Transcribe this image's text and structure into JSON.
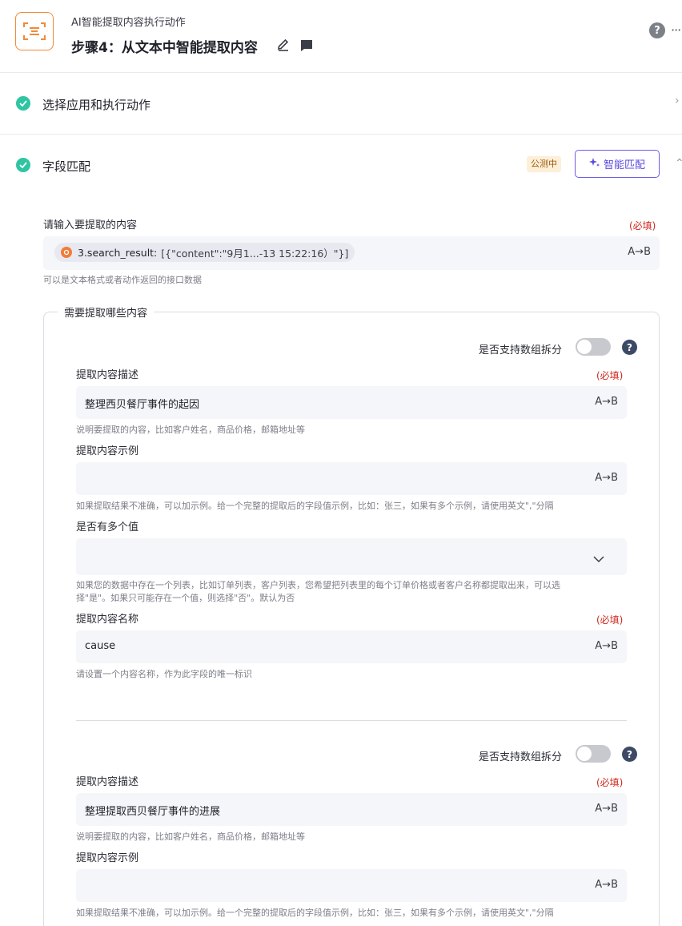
{
  "header": {
    "subtitle": "AI智能提取内容执行动作",
    "title": "步骤4：从文本中智能提取内容",
    "help_label": "?",
    "more_label": "···"
  },
  "sections": {
    "choose_app": {
      "title": "选择应用和执行动作",
      "chevron": "›"
    },
    "field_match": {
      "title": "字段匹配",
      "badge": "公测中",
      "smart_match_label": "智能匹配",
      "chevron": "⌃"
    }
  },
  "input_content": {
    "label": "请输入要提取的内容",
    "required": "(必填)",
    "token_key": "3.search_result:",
    "token_value": "[{\"content\":\"9月1...-13 15:22:16）\"}]",
    "ab_label": "A→B",
    "hint": "可以是文本格式或者动作返回的接口数据"
  },
  "extract_box": {
    "legend": "需要提取哪些内容",
    "items": [
      {
        "toggle_label": "是否支持数组拆分",
        "help": "?",
        "desc_label": "提取内容描述",
        "desc_required": "(必填)",
        "desc_value": "整理西贝餐厅事件的起因",
        "desc_hint": "说明要提取的内容，比如客户姓名，商品价格，邮箱地址等",
        "example_label": "提取内容示例",
        "example_value": "",
        "example_hint": "如果提取结果不准确，可以加示例。给一个完整的提取后的字段值示例，比如：张三，如果有多个示例，请使用英文\",\"分隔",
        "multi_label": "是否有多个值",
        "multi_value": "",
        "multi_hint_1": "如果您的数据中存在一个列表，比如订单列表，客户列表，您希望把列表里的每个订单价格或者客户名称都提取出来，可以选",
        "multi_hint_2": "择\"是\"。如果只可能存在一个值，则选择\"否\"。默认为否",
        "name_label": "提取内容名称",
        "name_required": "(必填)",
        "name_value": "cause",
        "name_hint": "请设置一个内容名称，作为此字段的唯一标识",
        "toggle_on": false
      },
      {
        "toggle_label": "是否支持数组拆分",
        "help": "?",
        "desc_label": "提取内容描述",
        "desc_required": "(必填)",
        "desc_value": "整理提取西贝餐厅事件的进展",
        "desc_hint": "说明要提取的内容，比如客户姓名，商品价格，邮箱地址等",
        "example_label": "提取内容示例",
        "example_value": "",
        "example_hint": "如果提取结果不准确，可以加示例。给一个完整的提取后的字段值示例，比如：张三，如果有多个示例，请使用英文\",\"分隔",
        "toggle_on": false
      }
    ]
  },
  "colors": {
    "accent_orange": "#f08a3a",
    "check_green": "#2fc5a3",
    "smart_purple": "#5a4be0",
    "required_red": "#d0271d"
  }
}
